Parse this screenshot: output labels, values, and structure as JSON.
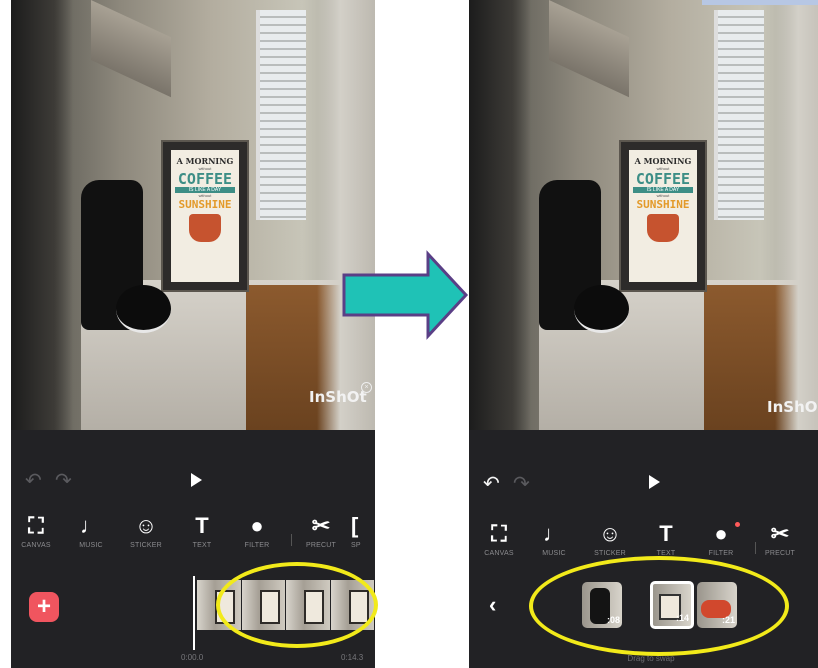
{
  "left_screen": {
    "watermark": "InShOt",
    "tools": [
      {
        "label": "CANVAS",
        "icon": "canvas-icon"
      },
      {
        "label": "MUSIC",
        "icon": "music-icon"
      },
      {
        "label": "STICKER",
        "icon": "sticker-icon"
      },
      {
        "label": "TEXT",
        "icon": "text-icon"
      },
      {
        "label": "FILTER",
        "icon": "filter-icon"
      },
      {
        "label": "PRECUT",
        "icon": "scissors-icon"
      },
      {
        "label": "SP",
        "icon": "split-icon"
      }
    ],
    "time_start": "0:00.0",
    "time_end": "0:14.3"
  },
  "right_screen": {
    "watermark": "InShO",
    "tools": [
      {
        "label": "CANVAS",
        "icon": "canvas-icon"
      },
      {
        "label": "MUSIC",
        "icon": "music-icon"
      },
      {
        "label": "STICKER",
        "icon": "sticker-icon"
      },
      {
        "label": "TEXT",
        "icon": "text-icon"
      },
      {
        "label": "FILTER",
        "icon": "filter-icon"
      },
      {
        "label": "PRECUT",
        "icon": "scissors-icon"
      }
    ],
    "clips": [
      {
        "duration": ":08"
      },
      {
        "duration": ":14"
      },
      {
        "duration": ":21"
      }
    ],
    "drag_hint": "Drag to swap"
  },
  "poster": {
    "line1": "A MORNING",
    "small": "without",
    "coffee": "COFFEE",
    "band": "IS LIKE A DAY",
    "small2": "without",
    "sunshine": "SUNSHINE"
  },
  "colors": {
    "arrow_fill": "#1fc2b6",
    "arrow_stroke": "#5a3f86",
    "highlight_ellipse": "#f2ea1a",
    "add_button": "#f0555f",
    "app_background": "#222225"
  }
}
